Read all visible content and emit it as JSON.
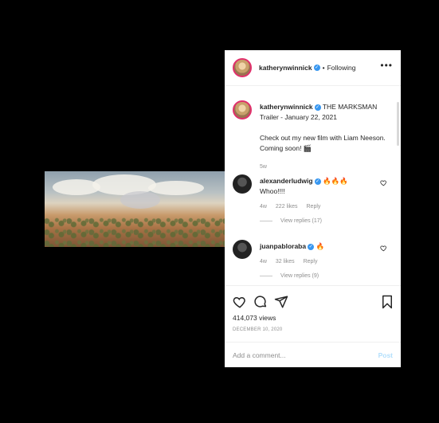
{
  "header": {
    "username": "katherynwinnick",
    "separator": "•",
    "follow_status": "Following"
  },
  "caption": {
    "username": "katherynwinnick",
    "text_line1": "THE MARKSMAN Trailer - January 22, 2021",
    "text_line2": "Check out my new film with Liam Neeson. Coming soon! 🎬",
    "age": "5w"
  },
  "comments": [
    {
      "username": "alexanderludwig",
      "emoji": "🔥🔥🔥",
      "text": "Whoo!!!!",
      "age": "4w",
      "likes": "222 likes",
      "reply": "Reply",
      "view_replies": "View replies (17)"
    },
    {
      "username": "juanpabloraba",
      "emoji": "🔥",
      "text": "",
      "age": "4w",
      "likes": "32 likes",
      "reply": "Reply",
      "view_replies": "View replies (9)"
    }
  ],
  "stats": {
    "views": "414,073 views",
    "date": "DECEMBER 10, 2020"
  },
  "comment_box": {
    "placeholder": "Add a comment...",
    "post_label": "Post"
  },
  "icons": {
    "like": "heart-icon",
    "comment": "comment-icon",
    "share": "share-icon",
    "save": "bookmark-icon",
    "verified": "verified-badge-icon",
    "more": "more-options-icon"
  },
  "colors": {
    "verified": "#3897f0",
    "story_ring": "#e1306c",
    "post_disabled": "#b2dffc"
  }
}
